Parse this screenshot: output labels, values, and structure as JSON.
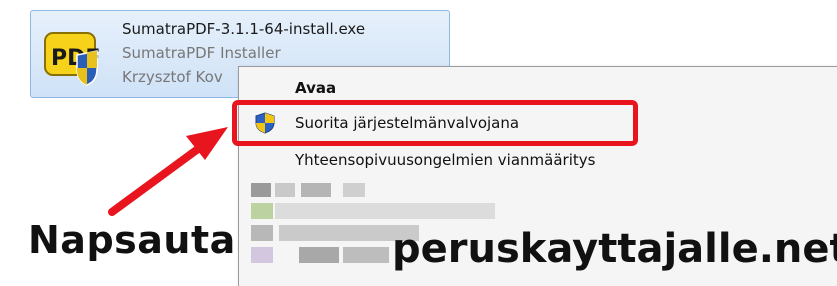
{
  "file": {
    "name": "SumatraPDF-3.1.1-64-install.exe",
    "description": "SumatraPDF Installer",
    "publisher": "Krzysztof Kov"
  },
  "context_menu": {
    "items": [
      {
        "label": "Avaa",
        "bold": true
      },
      {
        "label": "Suorita järjestelmänvalvojana",
        "icon": "uac-shield-icon",
        "highlighted": true
      },
      {
        "label": "Yhteensopivuusongelmien vianmääritys"
      }
    ]
  },
  "annotation": {
    "instruction": "Napsauta",
    "highlight_color": "#e8141e",
    "arrow_color": "#e8141e"
  },
  "watermark": "peruskayttajalle.net",
  "colors": {
    "tile_bg": "#cfe2f7",
    "menu_bg": "#f5f5f5"
  }
}
